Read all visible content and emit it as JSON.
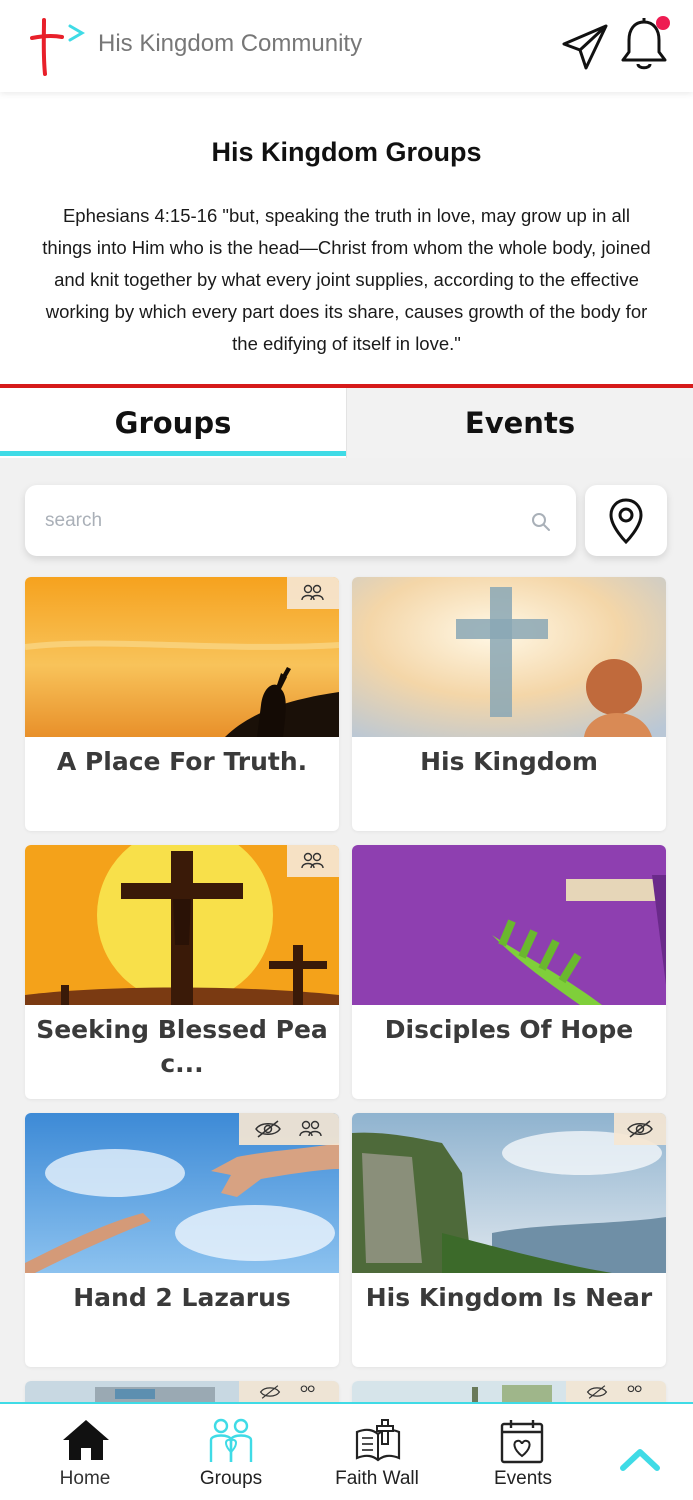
{
  "header": {
    "title": "His Kingdom Community",
    "logo_icon": "cross-logo-icon",
    "send_icon": "paper-plane-icon",
    "bell_icon": "bell-icon",
    "has_notification": true,
    "accent": "#ee1c52"
  },
  "intro": {
    "title": "His Kingdom Groups",
    "verse": "Ephesians 4:15-16 \"but, speaking the truth in love, may grow up in all things into Him who is the head—Christ from whom the whole body, joined and knit together by what every joint supplies, according to the effective working by which every part does its share, causes growth of the body for the edifying of itself in love.\""
  },
  "tabs": [
    {
      "label": "Groups",
      "active": true
    },
    {
      "label": "Events",
      "active": false
    }
  ],
  "search": {
    "placeholder": "search",
    "value": ""
  },
  "groups": [
    {
      "title": "A Place For Truth.",
      "badges": [
        "group-icon"
      ]
    },
    {
      "title": "His Kingdom",
      "badges": []
    },
    {
      "title": "Seeking Blessed Pea c...",
      "badges": [
        "group-icon"
      ]
    },
    {
      "title": "Disciples Of Hope",
      "badges": []
    },
    {
      "title": "Hand 2 Lazarus",
      "badges": [
        "hidden-eye-icon",
        "group-icon"
      ]
    },
    {
      "title": "His Kingdom Is Near",
      "badges": [
        "hidden-eye-icon"
      ]
    }
  ],
  "nav": [
    {
      "label": "Home",
      "icon": "home-icon",
      "active": true
    },
    {
      "label": "Groups",
      "icon": "groups-icon",
      "active": false
    },
    {
      "label": "Faith Wall",
      "icon": "bible-icon",
      "active": false
    },
    {
      "label": "Events",
      "icon": "calendar-icon",
      "active": false
    }
  ],
  "colors": {
    "accent_cyan": "#3fdbe6",
    "divider_red": "#d61a1a"
  }
}
